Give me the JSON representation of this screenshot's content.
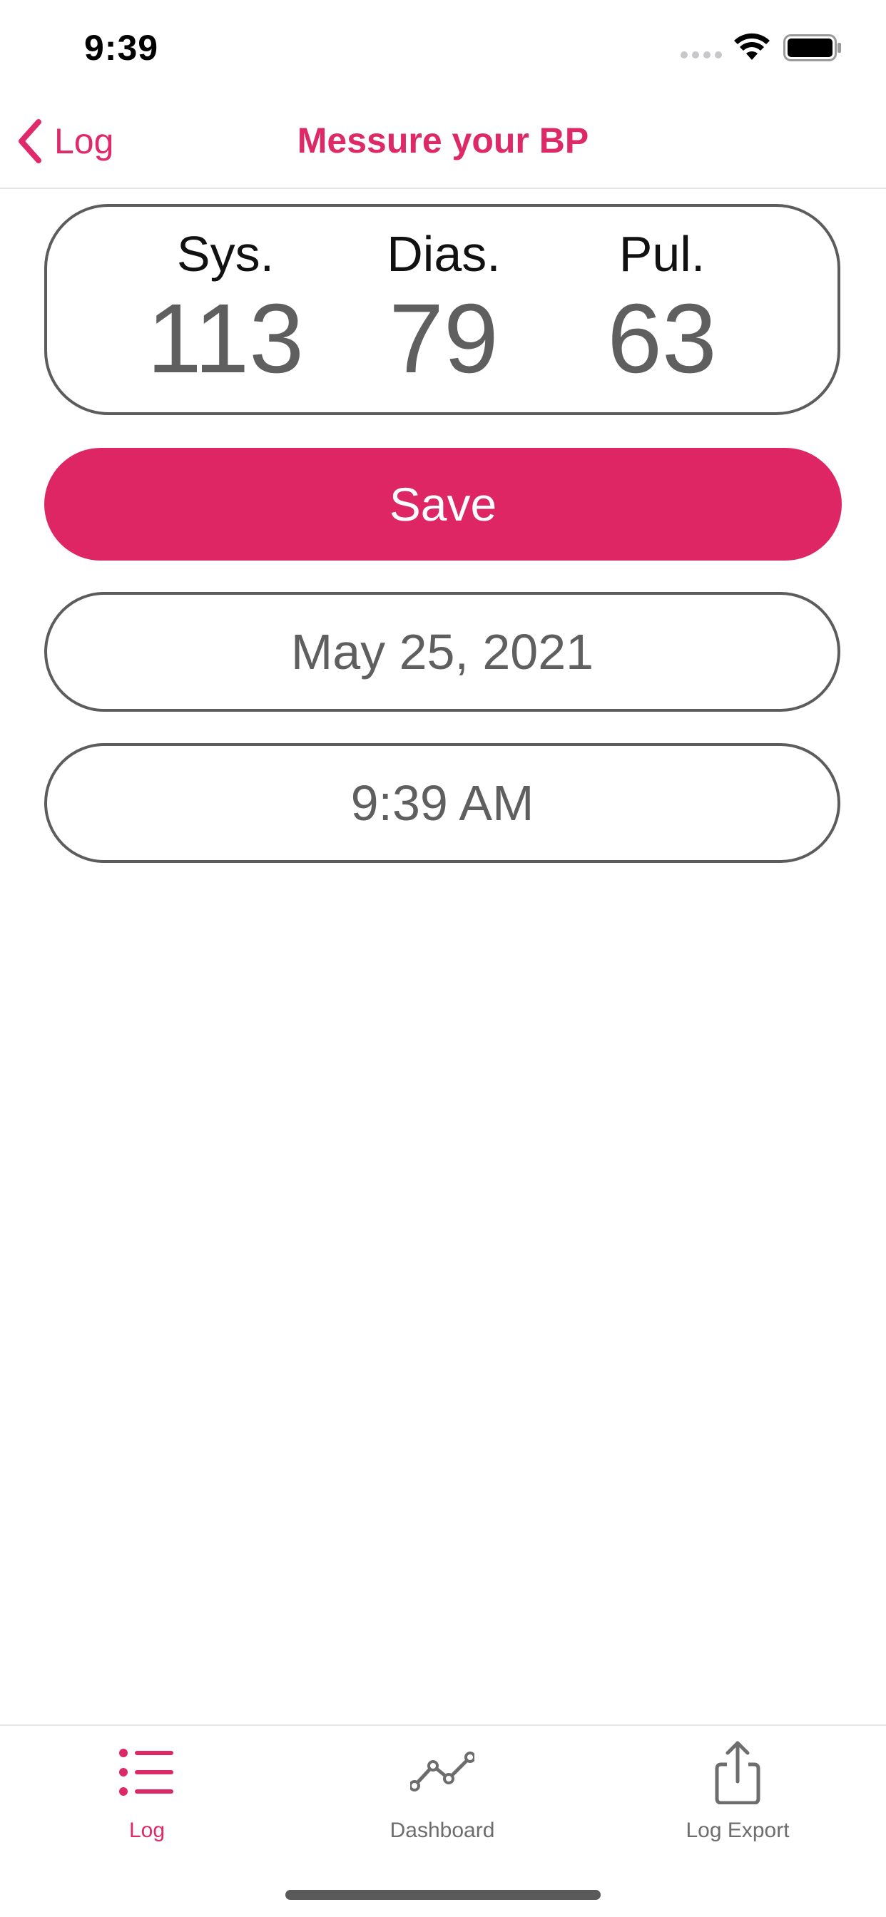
{
  "status_bar": {
    "time": "9:39"
  },
  "nav": {
    "back_label": "Log",
    "title": "Messure your BP"
  },
  "reading": {
    "systolic_label": "Sys.",
    "systolic_value": "113",
    "diastolic_label": "Dias.",
    "diastolic_value": "79",
    "pulse_label": "Pul.",
    "pulse_value": "63"
  },
  "actions": {
    "save_label": "Save"
  },
  "fields": {
    "date": "May 25, 2021",
    "time": "9:39 AM"
  },
  "tabs": [
    {
      "label": "Log",
      "icon": "list-icon",
      "active": true
    },
    {
      "label": "Dashboard",
      "icon": "line-chart-icon",
      "active": false
    },
    {
      "label": "Log Export",
      "icon": "share-icon",
      "active": false
    }
  ],
  "colors": {
    "accent": "#dd2a67",
    "button": "#dd2663",
    "border": "#5c5c5c",
    "value_text": "#5f5f5f"
  }
}
